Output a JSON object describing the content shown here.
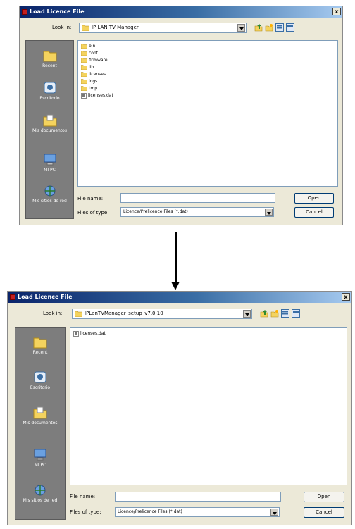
{
  "dialogs": [
    {
      "title": "Load Licence File",
      "close_label": "x",
      "look_in_label": "Look in:",
      "look_in_value": "IP LAN TV Manager",
      "places": [
        {
          "label": "Recent",
          "icon": "recent-folder-icon"
        },
        {
          "label": "Escritorio",
          "icon": "desktop-icon"
        },
        {
          "label": "Mis documentos",
          "icon": "my-documents-icon"
        },
        {
          "label": "MI PC",
          "icon": "my-computer-icon"
        },
        {
          "label": "Mis sitios de red",
          "icon": "network-places-icon"
        }
      ],
      "files": [
        {
          "name": "bin",
          "type": "folder"
        },
        {
          "name": "conf",
          "type": "folder"
        },
        {
          "name": "firmware",
          "type": "folder"
        },
        {
          "name": "lib",
          "type": "folder"
        },
        {
          "name": "licenses",
          "type": "folder"
        },
        {
          "name": "logs",
          "type": "folder"
        },
        {
          "name": "tmp",
          "type": "folder"
        },
        {
          "name": "licenses.dat",
          "type": "file"
        }
      ],
      "file_name_label": "File name:",
      "file_name_value": "",
      "files_of_type_label": "Files of type:",
      "files_of_type_value": "Licence/Prelicence Files (*.dat)",
      "open_label": "Open",
      "cancel_label": "Cancel"
    },
    {
      "title": "Load Licence File",
      "close_label": "x",
      "look_in_label": "Look in:",
      "look_in_value": "IPLanTVManager_setup_v7.0.10",
      "places": [
        {
          "label": "Recent",
          "icon": "recent-folder-icon"
        },
        {
          "label": "Escritorio",
          "icon": "desktop-icon"
        },
        {
          "label": "Mis documentos",
          "icon": "my-documents-icon"
        },
        {
          "label": "MI PC",
          "icon": "my-computer-icon"
        },
        {
          "label": "Mis sitios de red",
          "icon": "network-places-icon"
        }
      ],
      "files": [
        {
          "name": "licenses.dat",
          "type": "file"
        }
      ],
      "file_name_label": "File name:",
      "file_name_value": "",
      "files_of_type_label": "Files of type:",
      "files_of_type_value": "Licence/Prelicence Files (*.dat)",
      "open_label": "Open",
      "cancel_label": "Cancel"
    }
  ],
  "toolbar_icons": [
    "up-one-level-icon",
    "new-folder-icon",
    "list-view-icon",
    "details-view-icon"
  ],
  "colors": {
    "titlebar_start": "#0a246a",
    "titlebar_end": "#a6caf0",
    "dialog_bg": "#ece9d8",
    "places_bg": "#7d7d7d",
    "folder_yellow": "#f4d35e"
  }
}
